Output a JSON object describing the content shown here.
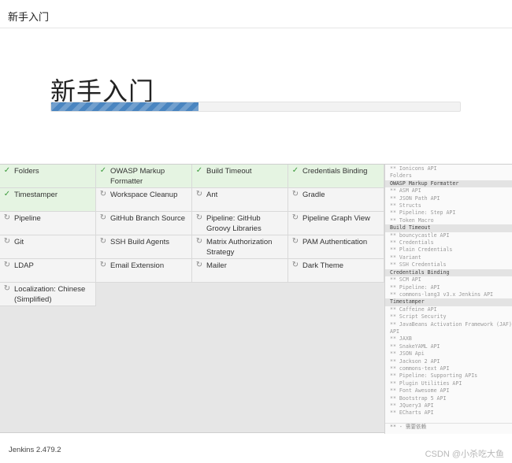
{
  "window": {
    "title": "新手入门"
  },
  "hero": {
    "heading": "新手入门",
    "progress_percent": 36
  },
  "plugins": [
    {
      "name": "Folders",
      "status": "installed"
    },
    {
      "name": "OWASP Markup Formatter",
      "status": "installed"
    },
    {
      "name": "Build Timeout",
      "status": "installed"
    },
    {
      "name": "Credentials Binding",
      "status": "installed"
    },
    {
      "name": "Timestamper",
      "status": "installed"
    },
    {
      "name": "Workspace Cleanup",
      "status": "pending"
    },
    {
      "name": "Ant",
      "status": "pending"
    },
    {
      "name": "Gradle",
      "status": "pending"
    },
    {
      "name": "Pipeline",
      "status": "pending"
    },
    {
      "name": "GitHub Branch Source",
      "status": "pending"
    },
    {
      "name": "Pipeline: GitHub Groovy Libraries",
      "status": "pending"
    },
    {
      "name": "Pipeline Graph View",
      "status": "pending"
    },
    {
      "name": "Git",
      "status": "pending"
    },
    {
      "name": "SSH Build Agents",
      "status": "pending"
    },
    {
      "name": "Matrix Authorization Strategy",
      "status": "pending"
    },
    {
      "name": "PAM Authentication",
      "status": "pending"
    },
    {
      "name": "LDAP",
      "status": "pending"
    },
    {
      "name": "Email Extension",
      "status": "pending"
    },
    {
      "name": "Mailer",
      "status": "pending"
    },
    {
      "name": "Dark Theme",
      "status": "pending"
    },
    {
      "name": "Localization: Chinese (Simplified)",
      "status": "pending"
    }
  ],
  "log": {
    "lines": [
      {
        "text": "** Ionicons API",
        "head": false
      },
      {
        "text": "Folders",
        "head": false
      },
      {
        "text": "OWASP Markup Formatter",
        "head": true
      },
      {
        "text": "** ASM API",
        "head": false
      },
      {
        "text": "** JSON Path API",
        "head": false
      },
      {
        "text": "** Structs",
        "head": false
      },
      {
        "text": "** Pipeline: Step API",
        "head": false
      },
      {
        "text": "** Token Macro",
        "head": false
      },
      {
        "text": "Build Timeout",
        "head": true
      },
      {
        "text": "** bouncycastle API",
        "head": false
      },
      {
        "text": "** Credentials",
        "head": false
      },
      {
        "text": "** Plain Credentials",
        "head": false
      },
      {
        "text": "** Variant",
        "head": false
      },
      {
        "text": "** SSH Credentials",
        "head": false
      },
      {
        "text": "Credentials Binding",
        "head": true
      },
      {
        "text": "** SCM API",
        "head": false
      },
      {
        "text": "** Pipeline: API",
        "head": false
      },
      {
        "text": "** commons-lang3 v3.x Jenkins API",
        "head": false
      },
      {
        "text": "Timestamper",
        "head": true
      },
      {
        "text": "** Caffeine API",
        "head": false
      },
      {
        "text": "** Script Security",
        "head": false
      },
      {
        "text": "** JavaBeans Activation Framework (JAF)",
        "head": false
      },
      {
        "text": "API",
        "head": false
      },
      {
        "text": "** JAXB",
        "head": false
      },
      {
        "text": "** SnakeYAML API",
        "head": false
      },
      {
        "text": "** JSON Api",
        "head": false
      },
      {
        "text": "** Jackson 2 API",
        "head": false
      },
      {
        "text": "** commons-text API",
        "head": false
      },
      {
        "text": "** Pipeline: Supporting APIs",
        "head": false
      },
      {
        "text": "** Plugin Utilities API",
        "head": false
      },
      {
        "text": "** Font Awesome API",
        "head": false
      },
      {
        "text": "** Bootstrap 5 API",
        "head": false
      },
      {
        "text": "** JQuery3 API",
        "head": false
      },
      {
        "text": "** ECharts API",
        "head": false
      }
    ],
    "footer": "** - 需要依赖"
  },
  "footer": {
    "version": "Jenkins 2.479.2",
    "watermark": "CSDN @小杀吃大鱼"
  },
  "icons": {
    "installed": "check-icon",
    "pending": "spinner-icon"
  },
  "colors": {
    "installed_bg": "#e5f4e2",
    "pending_bg": "#f4f4f4",
    "progress": "#4a85c0"
  }
}
